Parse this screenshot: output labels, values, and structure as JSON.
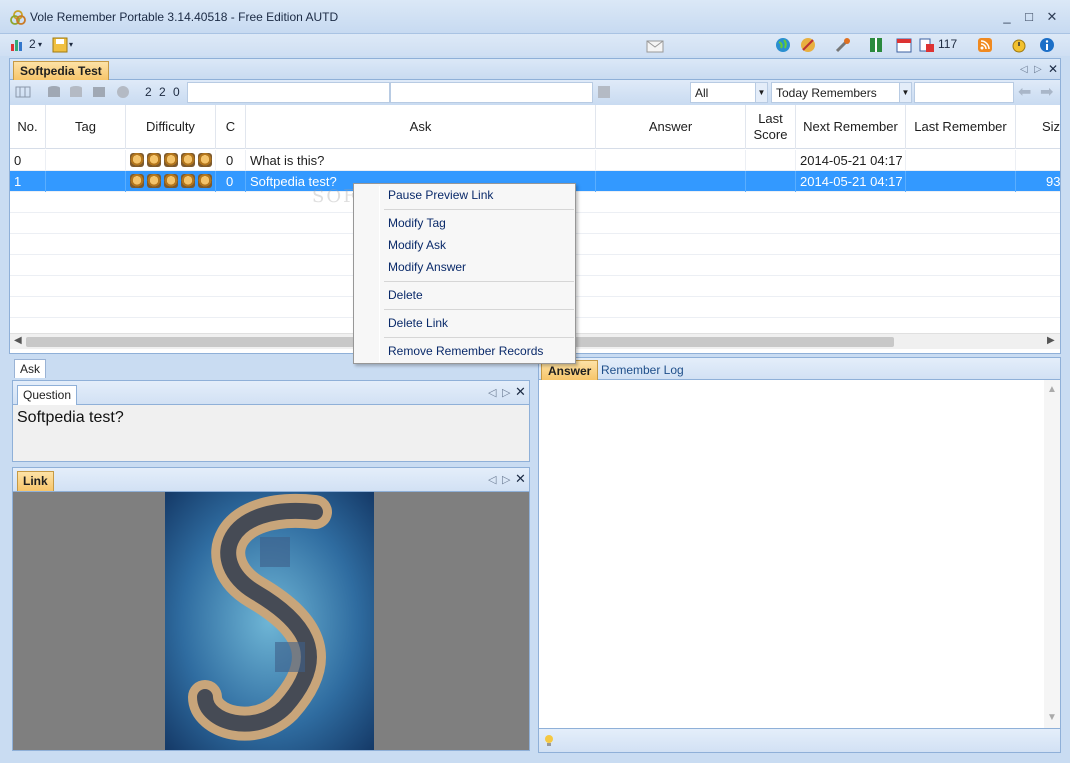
{
  "window": {
    "title": "Vole Remember Portable  3.14.40518 - Free Edition AUTD",
    "controls": [
      "_",
      "□",
      "✕"
    ]
  },
  "toolbar": {
    "left_count": "2",
    "right_count": "117"
  },
  "document": {
    "tab_label": "Softpedia Test"
  },
  "filterbar": {
    "numbers": "2 2 0",
    "filter_select": "All",
    "view_select": "Today Remembers"
  },
  "grid": {
    "columns": [
      "No.",
      "Tag",
      "Difficulty",
      "C",
      "Ask",
      "Answer",
      "Last Score",
      "Next Remember",
      "Last Remember",
      "Siz"
    ],
    "rows": [
      {
        "no": "0",
        "tag": "",
        "stars": 5,
        "c": "0",
        "ask": "What is this?",
        "answer": "",
        "last_score": "",
        "next": "2014-05-21 04:17",
        "last": "",
        "size": ""
      },
      {
        "no": "1",
        "tag": "",
        "stars": 5,
        "c": "0",
        "ask": "Softpedia test?",
        "answer": "",
        "last_score": "",
        "next": "2014-05-21 04:17",
        "last": "",
        "size": "93"
      }
    ]
  },
  "context_menu": {
    "items": [
      "Pause Preview Link",
      "Modify Tag",
      "Modify Ask",
      "Modify Answer",
      "Delete",
      "Delete Link",
      "Remove Remember Records"
    ]
  },
  "ask_panel": {
    "tab_label": "Ask",
    "question_tab": "Question",
    "question_text": "Softpedia test?",
    "link_tab": "Link"
  },
  "answer_panel": {
    "tab_answer": "Answer",
    "tab_log": "Remember Log"
  },
  "colors": {
    "selection": "#3399ff",
    "accent_orange": "#f7c56a",
    "chrome_blue": "#c9dcf2"
  }
}
